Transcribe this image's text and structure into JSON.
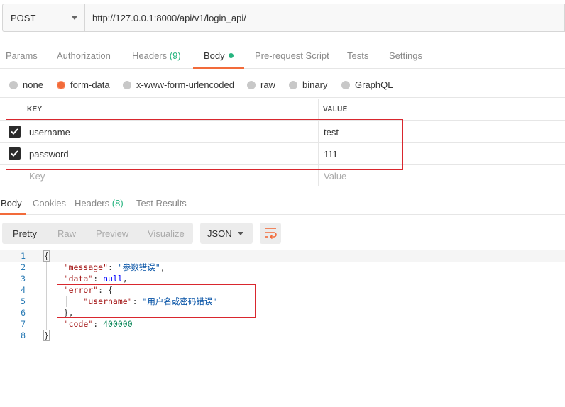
{
  "request": {
    "method": "POST",
    "url": "http://127.0.0.1:8000/api/v1/login_api/"
  },
  "request_tabs": [
    {
      "label": "Params"
    },
    {
      "label": "Authorization"
    },
    {
      "label": "Headers",
      "count": "(9)"
    },
    {
      "label": "Body"
    },
    {
      "label": "Pre-request Script"
    },
    {
      "label": "Tests"
    },
    {
      "label": "Settings"
    }
  ],
  "body_types": [
    "none",
    "form-data",
    "x-www-form-urlencoded",
    "raw",
    "binary",
    "GraphQL"
  ],
  "selected_body_type": "form-data",
  "kv_table": {
    "key_header": "KEY",
    "value_header": "VALUE",
    "rows": [
      {
        "key": "username",
        "value": "test",
        "checked": true
      },
      {
        "key": "password",
        "value": "111",
        "checked": true
      }
    ],
    "placeholder_key": "Key",
    "placeholder_value": "Value"
  },
  "response_tabs": [
    {
      "label": "Body"
    },
    {
      "label": "Cookies"
    },
    {
      "label": "Headers",
      "count": "(8)"
    },
    {
      "label": "Test Results"
    }
  ],
  "view_modes": [
    "Pretty",
    "Raw",
    "Preview",
    "Visualize"
  ],
  "format": "JSON",
  "response_body": {
    "line_numbers": [
      "1",
      "2",
      "3",
      "4",
      "5",
      "6",
      "7",
      "8"
    ],
    "message_key": "\"message\"",
    "message_value": "\"参数错误\"",
    "data_key": "\"data\"",
    "data_value": "null",
    "error_key": "\"error\"",
    "username_key": "\"username\"",
    "username_value": "\"用户名或密码错误\"",
    "code_key": "\"code\"",
    "code_value": "400000"
  },
  "colors": {
    "accent": "#f26b3a",
    "count_green": "#26b47f",
    "highlight_red": "#d9272e"
  },
  "icons": [
    "chevron-down-icon",
    "checkbox-checked-icon",
    "wrap-lines-icon"
  ]
}
